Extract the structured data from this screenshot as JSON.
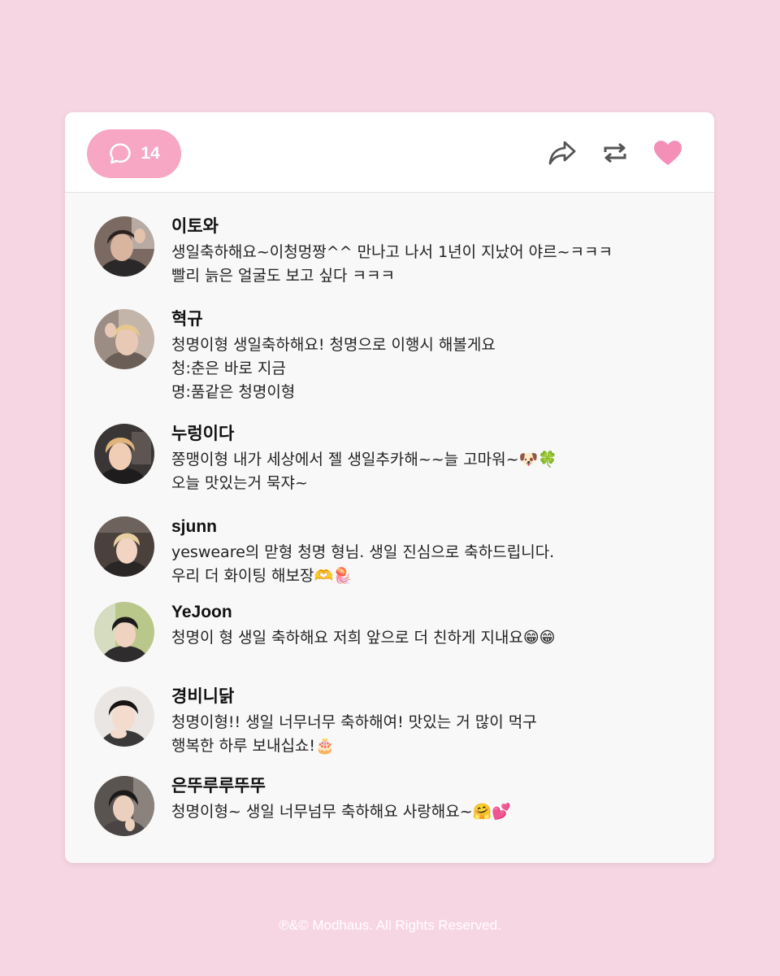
{
  "post": {
    "comment_count": "14",
    "colors": {
      "background": "#f7d6e3",
      "accent_pink": "#f7a6c4",
      "heart_pink": "#f48fb8",
      "icon_gray": "#555555"
    },
    "icons": {
      "comment": "speech-bubble-icon",
      "share": "share-arrow-icon",
      "repost": "repost-icon",
      "like": "heart-icon"
    }
  },
  "comments": [
    {
      "name": "이토와",
      "lines": [
        "생일축하해요~이청멍짱^^ 만나고 나서 1년이 지났어 야르~ㅋㅋㅋ",
        "빨리 늙은 얼굴도 보고 싶다 ㅋㅋㅋ"
      ]
    },
    {
      "name": "혁규",
      "lines": [
        "청명이형 생일축하해요! 청명으로 이행시 해볼게요",
        "청:춘은 바로 지금",
        "명:품같은 청명이형"
      ]
    },
    {
      "name": "누렁이다",
      "lines": [
        "쫑맹이형 내가 세상에서 젤 생일추카해~~늘 고마워~🐶🍀",
        "오늘 맛있는거 묵쟈~"
      ]
    },
    {
      "name": "sjunn",
      "lines": [
        "yesweare의 맏형 청명 형님. 생일 진심으로 축하드립니다.",
        "우리 더 화이팅 해보장🫶🪼"
      ]
    },
    {
      "name": "YeJoon",
      "lines": [
        "청명이 형 생일 축하해요 저희 앞으로 더 친하게 지내요😁😁"
      ]
    },
    {
      "name": "경비니닭",
      "lines": [
        "청명이형!! 생일 너무너무 축하해여! 맛있는 거 많이 먹구",
        "행복한 하루 보내십쇼!🎂"
      ]
    },
    {
      "name": "은뚜루루뚜뚜",
      "lines": [
        "청명이형~ 생일 너무넘무 축하해요 사랑해요~🤗💕"
      ]
    }
  ],
  "footer": "℗&© Modhaus. All Rights Reserved."
}
